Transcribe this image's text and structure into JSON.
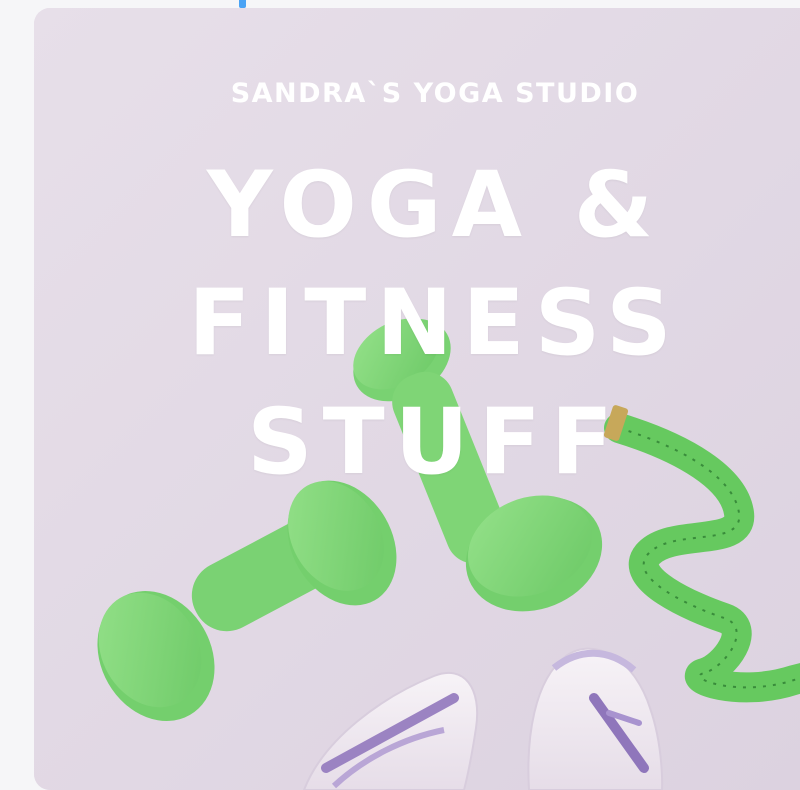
{
  "hero": {
    "eyebrow": "SANDRA`S YOGA STUDIO",
    "headline_lines": [
      "YOGA &",
      "FITNESS",
      "STUFF"
    ]
  },
  "colors": {
    "background": "#e4dbe7",
    "accent_green": "#86d97a",
    "text": "#ffffff",
    "focus_indicator": "#4aa3f5"
  },
  "icons": [
    "dumbbell-icon",
    "measuring-tape-icon",
    "sneaker-icon"
  ]
}
